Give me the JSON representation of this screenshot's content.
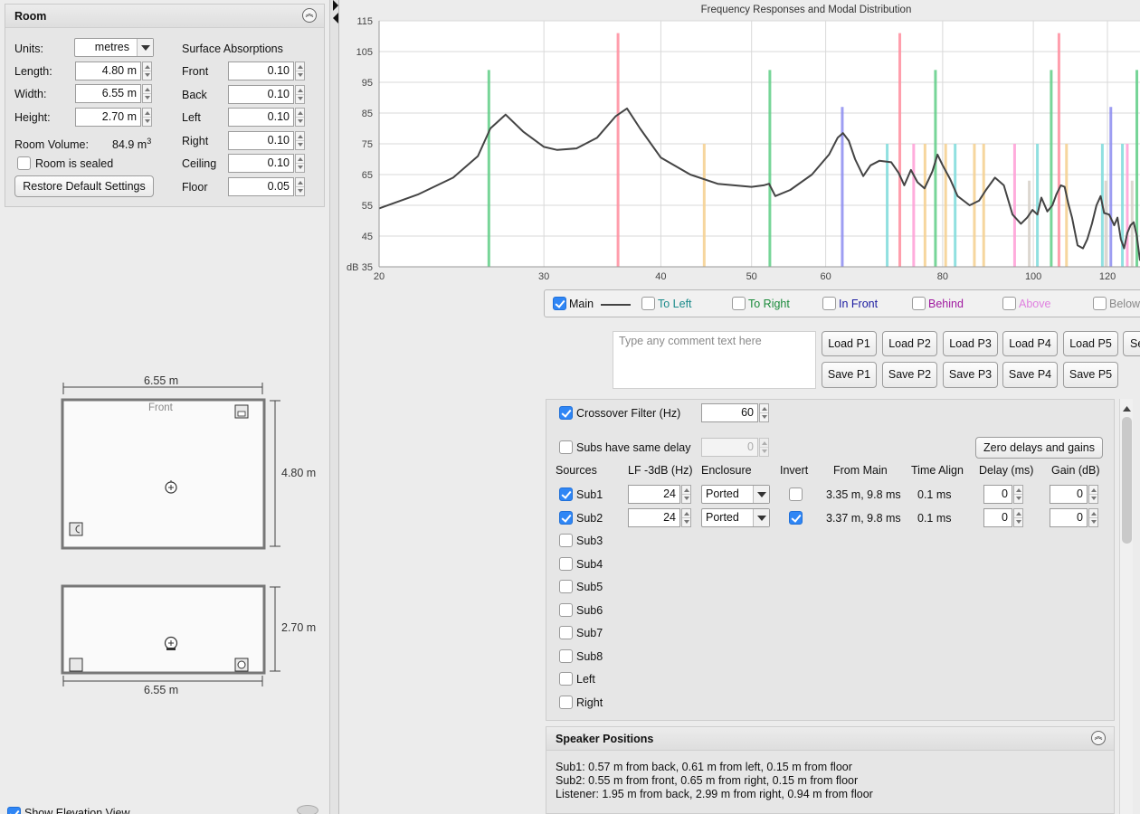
{
  "room": {
    "title": "Room",
    "units_label": "Units:",
    "units_value": "metres",
    "length_label": "Length:",
    "length_value": "4.80 m",
    "width_label": "Width:",
    "width_value": "6.55 m",
    "height_label": "Height:",
    "height_value": "2.70 m",
    "volume_label": "Room Volume:",
    "volume_value": "84.9 m",
    "volume_sup": "3",
    "sealed_label": "Room is sealed",
    "sealed_checked": false,
    "restore_label": "Restore Default Settings",
    "absorption_title": "Surface Absorptions",
    "absorptions": [
      {
        "label": "Front",
        "value": "0.10"
      },
      {
        "label": "Back",
        "value": "0.10"
      },
      {
        "label": "Left",
        "value": "0.10"
      },
      {
        "label": "Right",
        "value": "0.10"
      },
      {
        "label": "Ceiling",
        "value": "0.10"
      },
      {
        "label": "Floor",
        "value": "0.05"
      }
    ]
  },
  "plan": {
    "width_dim": "6.55 m",
    "depth_dim": "4.80 m",
    "front_label": "Front",
    "elev_height_dim": "2.70 m",
    "elev_width_dim": "6.55 m",
    "show_elevation_label": "Show Elevation View"
  },
  "chart_data": {
    "type": "line",
    "title": "Frequency Responses and Modal Distribution",
    "ylabel": "dB",
    "xlim": [
      20,
      130
    ],
    "ylim": [
      35,
      115
    ],
    "x_scale": "log",
    "x_ticks": [
      20,
      30,
      40,
      50,
      60,
      80,
      100,
      120
    ],
    "y_ticks": [
      35,
      45,
      55,
      65,
      75,
      85,
      95,
      105,
      115
    ],
    "grid": true,
    "series": [
      {
        "name": "Main",
        "color": "#444444",
        "x": [
          20,
          22,
          24,
          25.5,
          26.3,
          27.3,
          28.5,
          30,
          31,
          32.5,
          34.2,
          35.8,
          36.8,
          38,
          40,
          43,
          46,
          50,
          51.5,
          52.2,
          53,
          55,
          58,
          60.5,
          61.8,
          62.6,
          63.5,
          64.5,
          65.8,
          67,
          68.5,
          70.5,
          71.8,
          72.8,
          74,
          75.2,
          76.5,
          78,
          79,
          80,
          81.5,
          83,
          85.5,
          87.5,
          89,
          91,
          93,
          95,
          97,
          98.5,
          99.8,
          101,
          102,
          103.5,
          104.8,
          105.8,
          107,
          108,
          109,
          110,
          111.5,
          113,
          114.2,
          115.5,
          116.8,
          118,
          119,
          120.5,
          122,
          123,
          124,
          125,
          126,
          127,
          128,
          129,
          130
        ],
        "y": [
          54,
          58.5,
          64,
          71,
          80,
          84.5,
          79,
          74,
          73,
          73.5,
          77,
          84,
          86.5,
          80,
          70.5,
          65,
          62,
          61,
          61.5,
          62,
          58,
          60,
          65,
          71.5,
          77,
          78.5,
          76,
          70,
          64.5,
          68,
          69.5,
          69,
          65.5,
          61.5,
          66.5,
          62.5,
          60.5,
          66,
          71.5,
          68,
          63.5,
          58,
          55,
          56.5,
          60,
          64,
          61.5,
          52,
          49,
          51,
          53.5,
          52,
          57.5,
          53,
          55,
          58.5,
          61.5,
          61,
          55.5,
          51,
          42,
          41,
          44,
          49,
          55,
          58,
          52.5,
          52,
          48.5,
          51,
          44,
          41,
          46,
          48.5,
          49.5,
          45,
          37
        ]
      }
    ],
    "modes": [
      {
        "x": 26.2,
        "y": 99,
        "color": "#5fce86"
      },
      {
        "x": 36.0,
        "y": 111,
        "color": "#ff8d9e"
      },
      {
        "x": 44.5,
        "y": 75,
        "color": "#f5cf8d"
      },
      {
        "x": 52.3,
        "y": 99,
        "color": "#5fce86"
      },
      {
        "x": 62.5,
        "y": 87,
        "color": "#8c8cf0"
      },
      {
        "x": 69.8,
        "y": 75,
        "color": "#7cdbdb"
      },
      {
        "x": 72.0,
        "y": 111,
        "color": "#ff8d9e"
      },
      {
        "x": 74.5,
        "y": 75,
        "color": "#ff9ed6"
      },
      {
        "x": 76.6,
        "y": 75,
        "color": "#f5cf8d"
      },
      {
        "x": 78.6,
        "y": 99,
        "color": "#5fce86"
      },
      {
        "x": 80.6,
        "y": 75,
        "color": "#f5cf8d"
      },
      {
        "x": 82.5,
        "y": 75,
        "color": "#7cdbdb"
      },
      {
        "x": 86.5,
        "y": 75,
        "color": "#f5cf8d"
      },
      {
        "x": 88.5,
        "y": 75,
        "color": "#f5cf8d"
      },
      {
        "x": 95.5,
        "y": 75,
        "color": "#ff9ed6"
      },
      {
        "x": 99.0,
        "y": 63,
        "color": "#d6d0c8"
      },
      {
        "x": 101.0,
        "y": 75,
        "color": "#7cdbdb"
      },
      {
        "x": 104.5,
        "y": 99,
        "color": "#5fce86"
      },
      {
        "x": 106.5,
        "y": 111,
        "color": "#ff8d9e"
      },
      {
        "x": 108.5,
        "y": 75,
        "color": "#f5cf8d"
      },
      {
        "x": 118.5,
        "y": 75,
        "color": "#7cdbdb"
      },
      {
        "x": 119.5,
        "y": 63,
        "color": "#d6d0c8"
      },
      {
        "x": 121.0,
        "y": 87,
        "color": "#8c8cf0"
      },
      {
        "x": 124.5,
        "y": 75,
        "color": "#7cdbdb"
      },
      {
        "x": 126.0,
        "y": 75,
        "color": "#ff9ed6"
      },
      {
        "x": 127.5,
        "y": 63,
        "color": "#d6d0c8"
      },
      {
        "x": 129.0,
        "y": 99,
        "color": "#5fce86"
      }
    ]
  },
  "legend": {
    "items": [
      {
        "label": "Main",
        "checked": true,
        "color": "#111111"
      },
      {
        "label": "To Left",
        "checked": false,
        "color": "#1a8a8a"
      },
      {
        "label": "To Right",
        "checked": false,
        "color": "#1a8a3a"
      },
      {
        "label": "In Front",
        "checked": false,
        "color": "#1a1aa0"
      },
      {
        "label": "Behind",
        "checked": false,
        "color": "#a01aa0"
      },
      {
        "label": "Above",
        "checked": false,
        "color": "#e080e0"
      },
      {
        "label": "Below",
        "checked": false,
        "color": "#888888"
      }
    ]
  },
  "presets": {
    "comment_placeholder": "Type any comment text here",
    "load": [
      "Load P1",
      "Load P2",
      "Load P3",
      "Load P4",
      "Load P5",
      "Se"
    ],
    "save": [
      "Save P1",
      "Save P2",
      "Save P3",
      "Save P4",
      "Save P5"
    ]
  },
  "sources": {
    "crossover_label": "Crossover Filter (Hz)",
    "crossover_checked": true,
    "crossover_value": "60",
    "same_delay_label": "Subs have same delay",
    "same_delay_checked": false,
    "same_delay_value": "0",
    "zero_button": "Zero delays and gains",
    "headers": {
      "sources": "Sources",
      "lf": "LF -3dB (Hz)",
      "enclosure": "Enclosure",
      "invert": "Invert",
      "from_main": "From Main",
      "time_align": "Time Align",
      "delay": "Delay (ms)",
      "gain": "Gain (dB)"
    },
    "rows": [
      {
        "name": "Sub1",
        "checked": true,
        "lf": "24",
        "enclosure": "Ported",
        "invert": false,
        "from_main": "3.35 m, 9.8 ms",
        "time_align": "0.1 ms",
        "delay": "0",
        "gain": "0"
      },
      {
        "name": "Sub2",
        "checked": true,
        "lf": "24",
        "enclosure": "Ported",
        "invert": true,
        "from_main": "3.37 m, 9.8 ms",
        "time_align": "0.1 ms",
        "delay": "0",
        "gain": "0"
      },
      {
        "name": "Sub3",
        "checked": false
      },
      {
        "name": "Sub4",
        "checked": false
      },
      {
        "name": "Sub5",
        "checked": false
      },
      {
        "name": "Sub6",
        "checked": false
      },
      {
        "name": "Sub7",
        "checked": false
      },
      {
        "name": "Sub8",
        "checked": false
      },
      {
        "name": "Left",
        "checked": false
      },
      {
        "name": "Right",
        "checked": false
      }
    ]
  },
  "positions": {
    "title": "Speaker Positions",
    "lines": [
      "Sub1: 0.57 m from back, 0.61 m from left, 0.15 m from floor",
      "Sub2: 0.55 m from front, 0.65 m from right, 0.15 m from floor",
      "Listener: 1.95 m from back, 2.99 m from right, 0.94 m from floor"
    ]
  }
}
